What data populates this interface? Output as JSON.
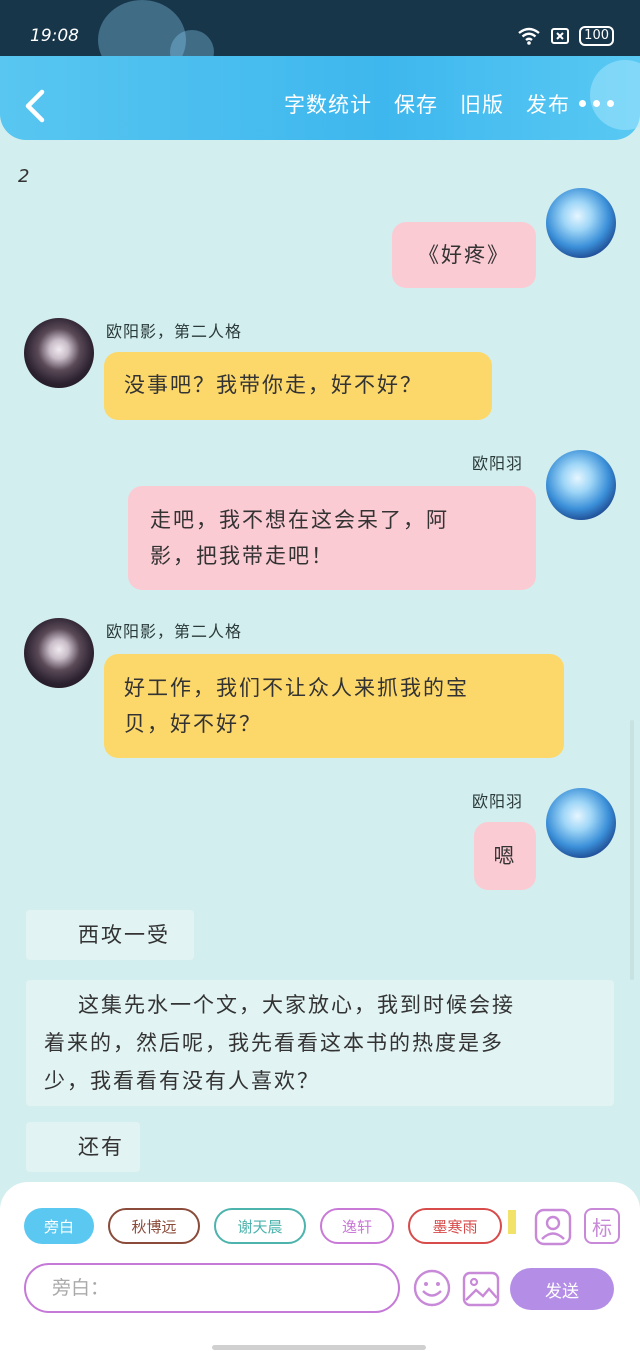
{
  "status_bar": {
    "time": "19:08",
    "battery": "100"
  },
  "toolbar": {
    "word_count": "字数统计",
    "save": "保存",
    "old_version": "旧版",
    "publish": "发布"
  },
  "chapter_number": "2",
  "messages": [
    {
      "side": "right",
      "speaker": "",
      "text": "《好疼》"
    },
    {
      "side": "left",
      "speaker": "欧阳影，第二人格",
      "text": "没事吧？我带你走，好不好？"
    },
    {
      "side": "right",
      "speaker": "欧阳羽",
      "line1": "走吧，我不想在这会呆了，阿",
      "line2": "影，把我带走吧！"
    },
    {
      "side": "left",
      "speaker": "欧阳影，第二人格",
      "line1": "好工作，我们不让众人来抓我的宝",
      "line2": "贝，好不好？"
    },
    {
      "side": "right",
      "speaker": "欧阳羽",
      "text": "嗯"
    }
  ],
  "narration": [
    {
      "text": "西攻一受"
    },
    {
      "line1": "这集先水一个文，大家放心，我到时候会接",
      "line2": "着来的，然后呢，我先看看这本书的热度是多",
      "line3": "少，我看看有没有人喜欢？"
    },
    {
      "text": "还有"
    }
  ],
  "character_chips": [
    {
      "label": "旁白",
      "color": "#5ac8f0"
    },
    {
      "label": "秋博远",
      "color": "#8a4b3a"
    },
    {
      "label": "谢天晨",
      "color": "#4db3ad"
    },
    {
      "label": "逸轩",
      "color": "#c97ad6"
    },
    {
      "label": "墨寒雨",
      "color": "#d84b4b"
    }
  ],
  "input": {
    "placeholder": "旁白："
  },
  "send_label": "发送",
  "tag_label": "标",
  "icons": {
    "back": "chevron-left-icon",
    "more": "more-dots-icon",
    "emoji": "smile-icon",
    "image": "image-icon",
    "person": "person-icon"
  }
}
